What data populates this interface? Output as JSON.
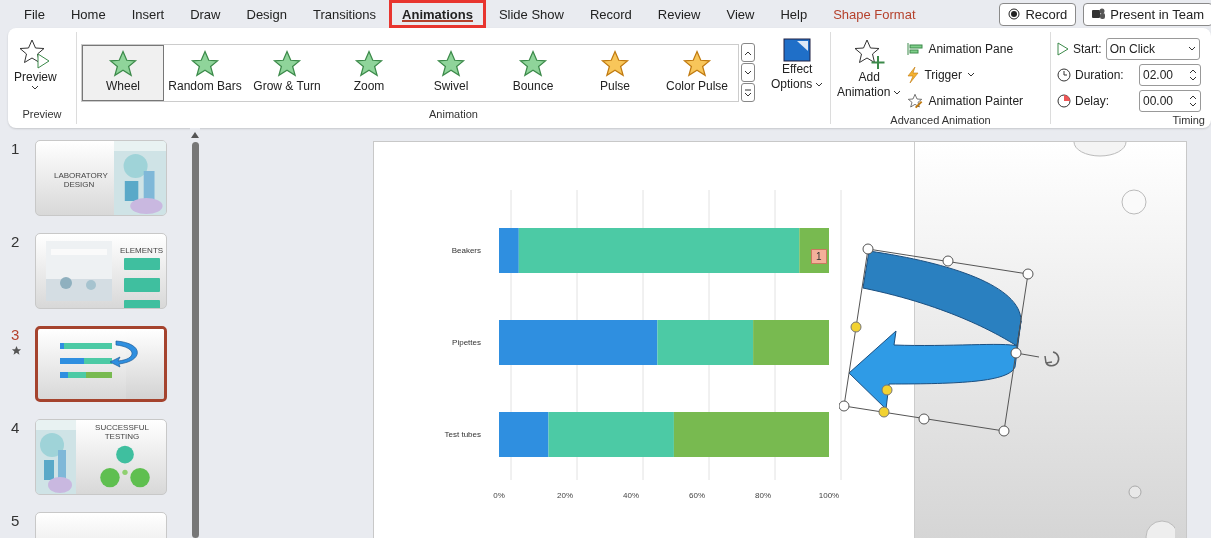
{
  "menu_tabs": [
    {
      "label": "File",
      "selected": false,
      "highlighted": false,
      "kind": "normal"
    },
    {
      "label": "Home",
      "selected": false,
      "highlighted": false,
      "kind": "normal"
    },
    {
      "label": "Insert",
      "selected": false,
      "highlighted": false,
      "kind": "normal"
    },
    {
      "label": "Draw",
      "selected": false,
      "highlighted": false,
      "kind": "normal"
    },
    {
      "label": "Design",
      "selected": false,
      "highlighted": false,
      "kind": "normal"
    },
    {
      "label": "Transitions",
      "selected": false,
      "highlighted": false,
      "kind": "normal"
    },
    {
      "label": "Animations",
      "selected": true,
      "highlighted": true,
      "kind": "normal"
    },
    {
      "label": "Slide Show",
      "selected": false,
      "highlighted": false,
      "kind": "normal"
    },
    {
      "label": "Record",
      "selected": false,
      "highlighted": false,
      "kind": "normal"
    },
    {
      "label": "Review",
      "selected": false,
      "highlighted": false,
      "kind": "normal"
    },
    {
      "label": "View",
      "selected": false,
      "highlighted": false,
      "kind": "normal"
    },
    {
      "label": "Help",
      "selected": false,
      "highlighted": false,
      "kind": "normal"
    },
    {
      "label": "Shape Format",
      "selected": false,
      "highlighted": false,
      "kind": "contextual"
    }
  ],
  "top_buttons": [
    {
      "label": "Record",
      "kind": "record"
    },
    {
      "label": "Present in Team",
      "kind": "teams"
    }
  ],
  "ribbon": {
    "preview": {
      "button": "Preview",
      "group_label": "Preview"
    },
    "animation_gallery": {
      "items": [
        {
          "label": "Wheel",
          "selected": true,
          "kind": "entrance"
        },
        {
          "label": "Random Bars",
          "selected": false,
          "kind": "entrance"
        },
        {
          "label": "Grow & Turn",
          "selected": false,
          "kind": "entrance"
        },
        {
          "label": "Zoom",
          "selected": false,
          "kind": "entrance"
        },
        {
          "label": "Swivel",
          "selected": false,
          "kind": "entrance"
        },
        {
          "label": "Bounce",
          "selected": false,
          "kind": "entrance"
        },
        {
          "label": "Pulse",
          "selected": false,
          "kind": "emphasis"
        },
        {
          "label": "Color Pulse",
          "selected": false,
          "kind": "emphasis"
        }
      ],
      "effect_options": [
        "Effect",
        "Options"
      ],
      "group_label": "Animation"
    },
    "advanced_animation": {
      "add_animation": [
        "Add",
        "Animation"
      ],
      "animation_pane": "Animation Pane",
      "trigger": "Trigger",
      "animation_painter": "Animation Painter",
      "group_label": "Advanced Animation"
    },
    "timing": {
      "start_label": "Start:",
      "start_value": "On Click",
      "duration_label": "Duration:",
      "duration_value": "02.00",
      "delay_label": "Delay:",
      "delay_value": "00.00",
      "group_label": "Timing"
    }
  },
  "slides": [
    {
      "number": "1",
      "selected": false,
      "animated": false,
      "kind": "title",
      "title": "LABORATORY DESIGN"
    },
    {
      "number": "2",
      "selected": false,
      "animated": false,
      "kind": "menu",
      "title": "ELEMENTS"
    },
    {
      "number": "3",
      "selected": true,
      "animated": true,
      "kind": "chart"
    },
    {
      "number": "4",
      "selected": false,
      "animated": false,
      "kind": "diagram",
      "title": "SUCCESSFUL TESTING"
    },
    {
      "number": "5",
      "selected": false,
      "animated": false,
      "kind": "blank"
    }
  ],
  "slide": {
    "animation_tag": "1",
    "chart_data": {
      "type": "bar",
      "orientation": "horizontal",
      "stacked": true,
      "categories": [
        "Beakers",
        "Pipettes",
        "Test tubes"
      ],
      "series": [
        {
          "color": "#2f8fe0",
          "values": [
            6,
            48,
            15
          ]
        },
        {
          "color": "#4ccaa5",
          "values": [
            85,
            29,
            38
          ]
        },
        {
          "color": "#78ba50",
          "values": [
            9,
            23,
            47
          ]
        }
      ],
      "xlim": [
        0,
        100
      ],
      "xticks": [
        {
          "value": 0,
          "label": "0%"
        },
        {
          "value": 20,
          "label": "20%"
        },
        {
          "value": 40,
          "label": "40%"
        },
        {
          "value": 60,
          "label": "60%"
        },
        {
          "value": 80,
          "label": "80%"
        },
        {
          "value": 100,
          "label": "100%"
        }
      ]
    }
  }
}
